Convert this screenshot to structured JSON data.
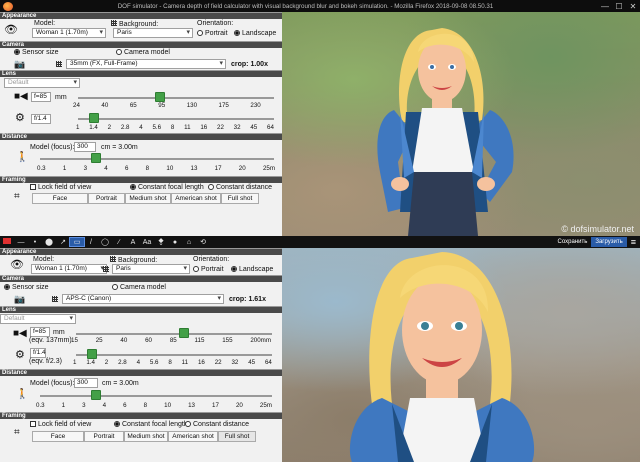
{
  "window": {
    "title": "DOF simulator - Camera depth of field calculator with visual background blur and bokeh simulation. - Mozilla Firefox 2018-09-08 08.50.31",
    "min": "—",
    "max": "☐",
    "close": "✕"
  },
  "sections": {
    "appearance": "Appearance",
    "camera": "Camera",
    "lens": "Lens",
    "distance": "Distance",
    "framing": "Framing"
  },
  "top": {
    "model_label": "Model:",
    "model_value": "Woman 1 (1.70m)",
    "background_label": "Background:",
    "background_value": "Paris",
    "orientation_label": "Orientation:",
    "portrait": "Portrait",
    "landscape": "Landscape",
    "sensor_size": "Sensor size",
    "camera_model": "Camera model",
    "sensor_value": "35mm (FX, Full-Frame)",
    "crop": "crop: 1.00x",
    "lens_preset": "Default",
    "focal_value": "f=85",
    "focal_unit": "mm",
    "focal_ticks": [
      "24",
      "40",
      "65",
      "95",
      "130",
      "175",
      "230",
      "300mm"
    ],
    "focal_level": 0.42,
    "aperture_value": "f/1.4",
    "aperture_ticks": [
      "1",
      "1.4",
      "2",
      "2.8",
      "4",
      "5.6",
      "8",
      "11",
      "16",
      "22",
      "32",
      "45",
      "64"
    ],
    "aperture_level": 0.08,
    "focus_label": "Model (focus):",
    "focus_value": "300",
    "focus_unit": "cm = 3.00m",
    "distance_ticks": [
      "0.3",
      "1",
      "3",
      "4",
      "6",
      "8",
      "10",
      "13",
      "17",
      "20",
      "25m"
    ],
    "distance_level": 0.24,
    "lock_fov": "Lock field of view",
    "const_focal": "Constant focal length",
    "const_distance": "Constant distance",
    "shots": [
      "Face",
      "Portrait",
      "Medium shot",
      "American shot",
      "Full shot"
    ]
  },
  "toolbar": {
    "save": "Сохранить",
    "upload": "Загрузить",
    "menu": "≡",
    "icons": [
      "—",
      "•",
      "⬤",
      "↗",
      "▭",
      "/",
      "◯",
      "∕",
      "A",
      "Aa",
      "⧪",
      "●",
      "⌂",
      "⟲"
    ]
  },
  "bottom": {
    "model_label": "Model:",
    "model_value": "Woman 1 (1.70m)",
    "background_label": "Background:",
    "background_value": "Paris",
    "orientation_label": "Orientation:",
    "portrait": "Portrait",
    "landscape": "Landscape",
    "sensor_size": "Sensor size",
    "camera_model": "Camera model",
    "sensor_value": "APS-C (Canon)",
    "crop": "crop: 1.61x",
    "lens_preset": "Default",
    "focal_value": "f=85",
    "focal_unit": "mm",
    "focal_eqv": "(eqv. 137mm)",
    "focal_ticks": [
      "15",
      "25",
      "40",
      "60",
      "85",
      "115",
      "155",
      "200mm"
    ],
    "focal_level": 0.55,
    "aperture_value": "f/1.4",
    "aperture_eqv": "(eqv. f/2.3)",
    "aperture_ticks": [
      "1",
      "1.4",
      "2",
      "2.8",
      "4",
      "5.6",
      "8",
      "11",
      "16",
      "22",
      "32",
      "45",
      "64"
    ],
    "aperture_level": 0.08,
    "focus_label": "Model (focus):",
    "focus_value": "300",
    "focus_unit": "cm = 3.00m",
    "distance_ticks": [
      "0.3",
      "1",
      "3",
      "4",
      "6",
      "8",
      "10",
      "13",
      "17",
      "20",
      "25m"
    ],
    "distance_level": 0.24,
    "lock_fov": "Lock field of view",
    "const_focal": "Constant focal length",
    "const_distance": "Constant distance",
    "shots": [
      "Face",
      "Portrait",
      "Medium shot",
      "American shot",
      "Full shot"
    ]
  },
  "watermark": "© dofsimulator.net"
}
